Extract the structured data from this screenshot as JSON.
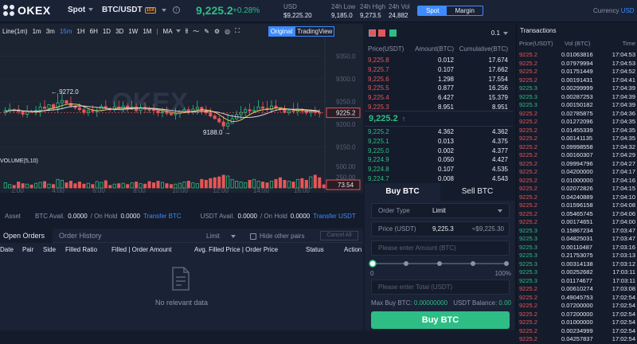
{
  "header": {
    "logo_text": "OKEX",
    "market_type": "Spot",
    "pair": "BTC/USDT",
    "leverage_badge": "10X",
    "info_icon": "i",
    "last_price": "9,225.2",
    "change_pct": "+0.28%",
    "usd_label": "USD",
    "usd_value": "$9,225.20",
    "low_label": "24h Low",
    "low_value": "9,185.0",
    "high_label": "24h High",
    "high_value": "9,273.5",
    "vol_label": "24h Vol",
    "vol_value": "24,882",
    "toggle_spot": "Spot",
    "toggle_margin": "Margin",
    "currency_label": "Currency",
    "currency_value": "USD"
  },
  "chart_toolbar": {
    "line_label": "Line(1m)",
    "intervals": [
      "1m",
      "3m",
      "15m",
      "1H",
      "6H",
      "1D",
      "3D",
      "1W",
      "1M"
    ],
    "active_interval": "15m",
    "indicator": "MA",
    "view_original": "Original",
    "view_tradingview": "TradingView"
  },
  "chart_data": {
    "type": "candlestick",
    "price_axis": [
      "9350.0",
      "9300.0",
      "9250.0",
      "9200.0",
      "9150.0"
    ],
    "price_min": 9130,
    "price_max": 9375,
    "volume_label": "VOLUME(5,10)",
    "volume_axis": [
      "500.00",
      "250.00"
    ],
    "volume_max": 560,
    "current_price_tag": "9225.2",
    "current_volume_tag": "73.54",
    "high_annotation": "9272.0",
    "low_annotation": "9188.0",
    "time_labels": [
      "2:00",
      "4:00",
      "6:00",
      "8:00",
      "10:00",
      "12:00",
      "14:00",
      "16:00"
    ],
    "watermark": "OKEX",
    "candles": [
      [
        9226,
        9230,
        9221,
        9219,
        9238
      ],
      [
        9230,
        9233,
        9224,
        9227,
        9246
      ],
      [
        9233,
        9232,
        9226,
        9231,
        9228
      ],
      [
        9232,
        9228,
        9222,
        9226,
        9242
      ],
      [
        9228,
        9222,
        9216,
        9221,
        9230
      ],
      [
        9222,
        9228,
        9214,
        9219,
        9242
      ],
      [
        9228,
        9226,
        9232,
        9232,
        9232
      ],
      [
        9226,
        9230,
        9219,
        9221,
        9240
      ],
      [
        9230,
        9238,
        9217,
        9221,
        9247
      ],
      [
        9238,
        9235,
        9226,
        9233,
        9253
      ],
      [
        9235,
        9243,
        9233,
        9228,
        9244
      ],
      [
        9243,
        9235,
        9233,
        9229,
        9247
      ],
      [
        9235,
        9247,
        9225,
        9227,
        9268
      ],
      [
        9247,
        9252,
        9233,
        9246,
        9267
      ],
      [
        9252,
        9246,
        9247,
        9251,
        9253
      ],
      [
        9246,
        9240,
        9240,
        9237,
        9261
      ],
      [
        9240,
        9236,
        9238,
        9232,
        9242
      ],
      [
        9236,
        9232,
        9232,
        9227,
        9246
      ],
      [
        9232,
        9226,
        9225,
        9221,
        9242
      ],
      [
        9226,
        9230,
        9227,
        9218,
        9234
      ],
      [
        9230,
        9228,
        9224,
        9225,
        9242
      ],
      [
        9228,
        9230,
        9224,
        9216,
        9237
      ],
      [
        9230,
        9239,
        9228,
        9229,
        9245
      ],
      [
        9239,
        9235,
        9232,
        9232,
        9253
      ],
      [
        9235,
        9232,
        9227,
        9228,
        9237
      ],
      [
        9232,
        9238,
        9227,
        9227,
        9250
      ],
      [
        9238,
        9235,
        9233,
        9233,
        9252
      ],
      [
        9235,
        9240,
        9226,
        9230,
        9250
      ],
      [
        9240,
        9233,
        9235,
        9227,
        9246
      ],
      [
        9233,
        9238,
        9231,
        9231,
        9252
      ],
      [
        9238,
        9230,
        9233,
        9225,
        9246
      ],
      [
        9230,
        9237,
        9227,
        9222,
        9246
      ],
      [
        9237,
        9233,
        9228,
        9225,
        9248
      ],
      [
        9233,
        9232,
        9232,
        9225,
        9239
      ],
      [
        9232,
        9230,
        9227,
        9221,
        9245
      ],
      [
        9230,
        9225,
        9221,
        9217,
        9230
      ],
      [
        9225,
        9227,
        9223,
        9215,
        9236
      ],
      [
        9227,
        9224,
        9220,
        9219,
        9239
      ],
      [
        9224,
        9221,
        9220,
        9218,
        9223
      ],
      [
        9221,
        9224,
        9219,
        9210,
        9236
      ],
      [
        9224,
        9228,
        9222,
        9214,
        9232
      ],
      [
        9228,
        9232,
        9224,
        9226,
        9237
      ],
      [
        9232,
        9229,
        9226,
        9221,
        9239
      ],
      [
        9229,
        9233,
        9232,
        9221,
        9242
      ],
      [
        9233,
        9237,
        9228,
        9221,
        9252
      ],
      [
        9237,
        9230,
        9232,
        9221,
        9239
      ],
      [
        9230,
        9225,
        9223,
        9219,
        9241
      ],
      [
        9225,
        9218,
        9220,
        9215,
        9236
      ],
      [
        9218,
        9212,
        9214,
        9212,
        9223
      ],
      [
        9212,
        9205,
        9206,
        9202,
        9219
      ],
      [
        9205,
        9196,
        9190,
        9188,
        9218
      ],
      [
        9196,
        9202,
        9189,
        9188,
        9223
      ],
      [
        9202,
        9212,
        9206,
        9206,
        9222
      ],
      [
        9212,
        9221,
        9209,
        9209,
        9230
      ],
      [
        9221,
        9226,
        9222,
        9211,
        9240
      ],
      [
        9226,
        9232,
        9223,
        9217,
        9238
      ],
      [
        9232,
        9229,
        9231,
        9219,
        9246
      ],
      [
        9229,
        9230,
        9232,
        9227,
        9240
      ],
      [
        9230,
        9238,
        9232,
        9230,
        9253
      ],
      [
        9238,
        9235,
        9234,
        9224,
        9249
      ],
      [
        9235,
        9232,
        9226,
        9226,
        9251
      ],
      [
        9232,
        9240,
        9237,
        9227,
        9253
      ],
      [
        9240,
        9236,
        9232,
        9229,
        9254
      ],
      [
        9236,
        9233,
        9231,
        9227,
        9238
      ],
      [
        9233,
        9226,
        9226,
        9224,
        9242
      ],
      [
        9226,
        9230,
        9227,
        9220,
        9234
      ],
      [
        9230,
        9228,
        9223,
        9224,
        9247
      ],
      [
        9228,
        9233,
        9227,
        9219,
        9247
      ],
      [
        9233,
        9230,
        9230,
        9223,
        9235
      ],
      [
        9230,
        9225,
        9220,
        9220,
        9229
      ],
      [
        9225,
        9228,
        9223,
        9216,
        9233
      ],
      [
        9228,
        9226,
        9224,
        9219,
        9239
      ],
      [
        9226,
        9225,
        9221,
        9215,
        9233
      ]
    ],
    "volumes": [
      120,
      80,
      60,
      140,
      100,
      90,
      70,
      110,
      130,
      150,
      90,
      80,
      200,
      180,
      120,
      160,
      100,
      140,
      90,
      110,
      80,
      150,
      130,
      170,
      60,
      90,
      100,
      110,
      80,
      120,
      140,
      100,
      90,
      150,
      120,
      160,
      130,
      100,
      80,
      90,
      110,
      140,
      160,
      120,
      100,
      200,
      180,
      220,
      240,
      260,
      300,
      280,
      200,
      160,
      140,
      120,
      180,
      200,
      160,
      140,
      120,
      160,
      200,
      240,
      180,
      160,
      140,
      200,
      220,
      180,
      260,
      300,
      240,
      74
    ]
  },
  "orderbook": {
    "precision": "0.1",
    "col_price": "Price(USDT)",
    "col_amount": "Amount(BTC)",
    "col_cum": "Cumulative(BTC)",
    "asks": [
      [
        "9,225.8",
        "0.012",
        "17.674"
      ],
      [
        "9,225.7",
        "0.107",
        "17.662"
      ],
      [
        "9,225.6",
        "1.298",
        "17.554"
      ],
      [
        "9,225.5",
        "0.877",
        "16.256"
      ],
      [
        "9,225.4",
        "6.427",
        "15.379"
      ],
      [
        "9,225.3",
        "8.951",
        "8.951"
      ]
    ],
    "mid_price": "9,225.2",
    "bids": [
      [
        "9,225.2",
        "4.362",
        "4.362"
      ],
      [
        "9,225.1",
        "0.013",
        "4.375"
      ],
      [
        "9,225.0",
        "0.002",
        "4.377"
      ],
      [
        "9,224.9",
        "0.050",
        "4.427"
      ],
      [
        "9,224.8",
        "0.107",
        "4.535"
      ],
      [
        "9,224.7",
        "0.008",
        "4.543"
      ]
    ],
    "ask_depth": [
      0.0,
      0.0,
      0.0,
      0.0,
      0.0,
      0.0
    ],
    "bid_depth": [
      0.0,
      0.0,
      0.0,
      0.0,
      0.0,
      0.0
    ]
  },
  "form": {
    "tab_buy": "Buy BTC",
    "tab_sell": "Sell BTC",
    "order_type_label": "Order Type",
    "order_type_value": "Limit",
    "price_label": "Price (USDT)",
    "price_value": "9,225.3",
    "price_approx": "≈$9,225.30",
    "amount_placeholder": "Please enter Amount (BTC)",
    "slider_min": "0",
    "slider_max": "100%",
    "total_placeholder": "Please enter Total (USDT)",
    "max_buy_label": "Max Buy BTC:",
    "max_buy_value": "0.00000000",
    "balance_label": "USDT Balance:",
    "balance_value": "0.00",
    "submit": "Buy BTC"
  },
  "assets": {
    "label": "Asset",
    "btc_avail": "BTC  Avail.",
    "btc_avail_val": "0.0000",
    "btc_hold": "/ On Hold",
    "btc_hold_val": "0.0000",
    "transfer_btc": "Transfer BTC",
    "usdt_avail": "USDT  Avail.",
    "usdt_avail_val": "0.0000",
    "usdt_hold": "/ On Hold",
    "usdt_hold_val": "0.0000",
    "transfer_usdt": "Transfer USDT"
  },
  "orders": {
    "tab_open": "Open Orders",
    "tab_history": "Order History",
    "filter": "Limit",
    "hide_pairs": "Hide other pairs",
    "cancel_all": "Cancel All",
    "columns": [
      "Date",
      "Pair",
      "Side",
      "Filled Ratio",
      "Filled | Order Amount",
      "Avg. Filled Price | Order Price",
      "Status",
      "Action"
    ],
    "empty": "No relevant data"
  },
  "transactions": {
    "title": "Transactions",
    "col_price": "Price(USDT)",
    "col_vol": "Vol (BTC)",
    "col_time": "Time",
    "rows": [
      [
        "9225.2",
        "0.01063816",
        "17:04:53",
        "r"
      ],
      [
        "9225.2",
        "0.07979994",
        "17:04:53",
        "r"
      ],
      [
        "9225.2",
        "0.01751449",
        "17:04:52",
        "r"
      ],
      [
        "9225.2",
        "0.00191431",
        "17:04:41",
        "r"
      ],
      [
        "9225.3",
        "0.00299999",
        "17:04:39",
        "g"
      ],
      [
        "9225.3",
        "0.00287253",
        "17:04:39",
        "g"
      ],
      [
        "9225.3",
        "0.00150182",
        "17:04:39",
        "g"
      ],
      [
        "9225.2",
        "0.02785875",
        "17:04:36",
        "r"
      ],
      [
        "9225.2",
        "0.01272096",
        "17:04:35",
        "r"
      ],
      [
        "9225.2",
        "0.01455339",
        "17:04:35",
        "r"
      ],
      [
        "9225.2",
        "0.00141135",
        "17:04:35",
        "r"
      ],
      [
        "9225.2",
        "0.09998558",
        "17:04:32",
        "r"
      ],
      [
        "9225.2",
        "0.00160307",
        "17:04:29",
        "r"
      ],
      [
        "9225.2",
        "0.09994796",
        "17:04:27",
        "r"
      ],
      [
        "9225.2",
        "0.04200000",
        "17:04:17",
        "r"
      ],
      [
        "9225.2",
        "0.01000000",
        "17:04:16",
        "r"
      ],
      [
        "9225.2",
        "0.02072826",
        "17:04:15",
        "r"
      ],
      [
        "9225.2",
        "0.04240889",
        "17:04:10",
        "r"
      ],
      [
        "9225.2",
        "0.01596158",
        "17:04:08",
        "r"
      ],
      [
        "9225.2",
        "0.05465745",
        "17:04:06",
        "r"
      ],
      [
        "9225.2",
        "0.00174651",
        "17:04:00",
        "r"
      ],
      [
        "9225.3",
        "0.15867234",
        "17:03:47",
        "g"
      ],
      [
        "9225.3",
        "0.04825031",
        "17:03:47",
        "g"
      ],
      [
        "9225.3",
        "0.00110487",
        "17:03:16",
        "g"
      ],
      [
        "9225.3",
        "0.21753075",
        "17:03:13",
        "g"
      ],
      [
        "9225.3",
        "0.00314138",
        "17:03:12",
        "g"
      ],
      [
        "9225.3",
        "0.00252682",
        "17:03:11",
        "g"
      ],
      [
        "9225.3",
        "0.01174677",
        "17:03:11",
        "g"
      ],
      [
        "9225.2",
        "0.00610274",
        "17:03:08",
        "r"
      ],
      [
        "9225.2",
        "0.49045753",
        "17:02:54",
        "r"
      ],
      [
        "9225.2",
        "0.07200000",
        "17:02:54",
        "r"
      ],
      [
        "9225.2",
        "0.07200000",
        "17:02:54",
        "r"
      ],
      [
        "9225.2",
        "0.01000000",
        "17:02:54",
        "r"
      ],
      [
        "9225.2",
        "0.00234999",
        "17:02:54",
        "r"
      ],
      [
        "9225.2",
        "0.04257837",
        "17:02:54",
        "r"
      ]
    ]
  }
}
